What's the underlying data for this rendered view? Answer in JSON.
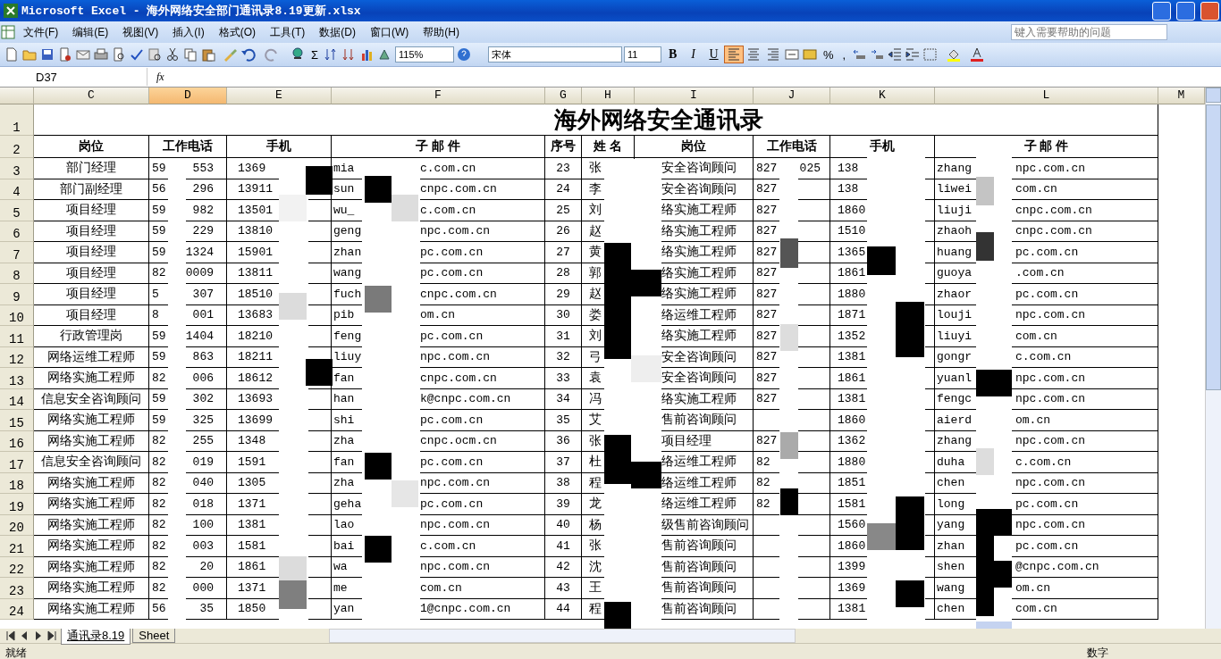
{
  "window": {
    "title": "Microsoft Excel - 海外网络安全部门通讯录8.19更新.xlsx"
  },
  "menu": [
    "文件(F)",
    "编辑(E)",
    "视图(V)",
    "插入(I)",
    "格式(O)",
    "工具(T)",
    "数据(D)",
    "窗口(W)",
    "帮助(H)"
  ],
  "help_box": {
    "placeholder": "键入需要帮助的问题"
  },
  "toolbar": {
    "zoom": "115%",
    "sum": "Σ",
    "font": "宋体",
    "size": "11",
    "bold": "B",
    "italic": "I",
    "underline": "U",
    "percent": "%",
    "comma": ",",
    "align": [
      {
        "selected": true
      },
      {
        "selected": false
      },
      {
        "selected": false
      }
    ]
  },
  "formula_bar": {
    "cell": "D37",
    "fx": "fx"
  },
  "columns": [
    {
      "label": "C",
      "selected": false
    },
    {
      "label": "D",
      "selected": true
    },
    {
      "label": "E",
      "selected": false
    },
    {
      "label": "F",
      "selected": false
    },
    {
      "label": "G",
      "selected": false
    },
    {
      "label": "H",
      "selected": false
    },
    {
      "label": "I",
      "selected": false
    },
    {
      "label": "J",
      "selected": false
    },
    {
      "label": "K",
      "selected": false
    },
    {
      "label": "L",
      "selected": false
    },
    {
      "label": "M",
      "selected": false
    }
  ],
  "sheet_title": {
    "row": "1",
    "text": "海外网络安全通讯录"
  },
  "header": {
    "row": "2",
    "left": [
      "岗位",
      "工作电话",
      "手机",
      "子 邮 件"
    ],
    "right": [
      "序号",
      "姓  名",
      "岗位",
      "工作电话",
      "手机",
      "子 邮 件"
    ]
  },
  "rows": [
    {
      "num": "3",
      "left": {
        "post": "部门经理",
        "tel": [
          "59",
          "553"
        ],
        "mobile": "1369",
        "email": [
          "mia",
          "c.com.cn"
        ]
      },
      "right": {
        "seq": "23",
        "name": "张",
        "post": "安全咨询顾问",
        "tel": [
          "827",
          "025"
        ],
        "mobile": "138",
        "email": [
          "zhang",
          "npc.com.cn"
        ]
      }
    },
    {
      "num": "4",
      "left": {
        "post": "部门副经理",
        "tel": [
          "56",
          "296"
        ],
        "mobile": "13911",
        "email": [
          "sun",
          "cnpc.com.cn"
        ]
      },
      "right": {
        "seq": "24",
        "name": "李",
        "post": "安全咨询顾问",
        "tel": [
          "827"
        ],
        "mobile": "138",
        "email": [
          "liwei",
          "com.cn"
        ]
      }
    },
    {
      "num": "5",
      "left": {
        "post": "项目经理",
        "tel": [
          "59",
          "982"
        ],
        "mobile": "13501",
        "email": [
          "wu_",
          "c.com.cn"
        ]
      },
      "right": {
        "seq": "25",
        "name": "刘",
        "post": "络实施工程师",
        "tel": [
          "827"
        ],
        "mobile": "1860",
        "email": [
          "liuji",
          "cnpc.com.cn"
        ]
      }
    },
    {
      "num": "6",
      "left": {
        "post": "项目经理",
        "tel": [
          "59",
          "229"
        ],
        "mobile": "13810",
        "email": [
          "geng",
          "npc.com.cn"
        ]
      },
      "right": {
        "seq": "26",
        "name": "赵",
        "post": "络实施工程师",
        "tel": [
          "827"
        ],
        "mobile": "1510",
        "email": [
          "zhaoh",
          "cnpc.com.cn"
        ]
      }
    },
    {
      "num": "7",
      "left": {
        "post": "项目经理",
        "tel": [
          "59",
          "1324"
        ],
        "mobile": "15901",
        "email": [
          "zhan",
          "pc.com.cn"
        ]
      },
      "right": {
        "seq": "27",
        "name": "黄",
        "post": "络实施工程师",
        "tel": [
          "827"
        ],
        "mobile": "1365",
        "email": [
          "huang",
          "pc.com.cn"
        ]
      }
    },
    {
      "num": "8",
      "left": {
        "post": "项目经理",
        "tel": [
          "82",
          "0009"
        ],
        "mobile": "13811",
        "email": [
          "wang",
          "pc.com.cn"
        ]
      },
      "right": {
        "seq": "28",
        "name": "郭",
        "post": "络实施工程师",
        "tel": [
          "827"
        ],
        "mobile": "1861",
        "email": [
          "guoya",
          ".com.cn"
        ]
      }
    },
    {
      "num": "9",
      "left": {
        "post": "项目经理",
        "tel": [
          "5",
          "307"
        ],
        "mobile": "18510",
        "email": [
          "fuch",
          "cnpc.com.cn"
        ]
      },
      "right": {
        "seq": "29",
        "name": "赵",
        "post": "络实施工程师",
        "tel": [
          "827"
        ],
        "mobile": "1880",
        "email": [
          "zhaor",
          "pc.com.cn"
        ]
      }
    },
    {
      "num": "10",
      "left": {
        "post": "项目经理",
        "tel": [
          "8",
          "001"
        ],
        "mobile": "13683",
        "email": [
          "pib",
          "om.cn"
        ]
      },
      "right": {
        "seq": "30",
        "name": "娄",
        "post": "络运维工程师",
        "tel": [
          "827"
        ],
        "mobile": "1871",
        "email": [
          "louji",
          "npc.com.cn"
        ]
      }
    },
    {
      "num": "11",
      "left": {
        "post": "行政管理岗",
        "tel": [
          "59",
          "1404"
        ],
        "mobile": "18210",
        "email": [
          "feng",
          "pc.com.cn"
        ]
      },
      "right": {
        "seq": "31",
        "name": "刘",
        "post": "络实施工程师",
        "tel": [
          "827"
        ],
        "mobile": "1352",
        "email": [
          "liuyi",
          "com.cn"
        ]
      }
    },
    {
      "num": "12",
      "left": {
        "post": "网络运维工程师",
        "tel": [
          "59",
          "863"
        ],
        "mobile": "18211",
        "email": [
          "liuy",
          "npc.com.cn"
        ]
      },
      "right": {
        "seq": "32",
        "name": "弓",
        "post": "安全咨询顾问",
        "tel": [
          "827"
        ],
        "mobile": "1381",
        "email": [
          "gongr",
          "c.com.cn"
        ]
      }
    },
    {
      "num": "13",
      "left": {
        "post": "网络实施工程师",
        "tel": [
          "82",
          "006"
        ],
        "mobile": "18612",
        "email": [
          "fan",
          "cnpc.com.cn"
        ]
      },
      "right": {
        "seq": "33",
        "name": "袁",
        "post": "安全咨询顾问",
        "tel": [
          "827"
        ],
        "mobile": "1861",
        "email": [
          "yuanl",
          "npc.com.cn"
        ]
      }
    },
    {
      "num": "14",
      "left": {
        "post": "信息安全咨询顾问",
        "tel": [
          "59",
          "302"
        ],
        "mobile": "13693",
        "email": [
          "han",
          "k@cnpc.com.cn"
        ]
      },
      "right": {
        "seq": "34",
        "name": "冯",
        "post": "络实施工程师",
        "tel": [
          "827"
        ],
        "mobile": "1381",
        "email": [
          "fengc",
          "npc.com.cn"
        ]
      }
    },
    {
      "num": "15",
      "left": {
        "post": "网络实施工程师",
        "tel": [
          "59",
          "325"
        ],
        "mobile": "13699",
        "email": [
          "shi",
          "pc.com.cn"
        ]
      },
      "right": {
        "seq": "35",
        "name": "艾",
        "post": "售前咨询顾问",
        "mobile": "1860",
        "email": [
          "aierd",
          "om.cn"
        ]
      }
    },
    {
      "num": "16",
      "left": {
        "post": "网络实施工程师",
        "tel": [
          "82",
          "255"
        ],
        "mobile": "1348",
        "email": [
          "zha",
          "cnpc.ocm.cn"
        ]
      },
      "right": {
        "seq": "36",
        "name": "张",
        "post": "项目经理",
        "tel": [
          "827"
        ],
        "mobile": "1362",
        "email": [
          "zhang",
          "npc.com.cn"
        ]
      }
    },
    {
      "num": "17",
      "left": {
        "post": "信息安全咨询顾问",
        "tel": [
          "82",
          "019"
        ],
        "mobile": "1591",
        "email": [
          "fan",
          "pc.com.cn"
        ]
      },
      "right": {
        "seq": "37",
        "name": "杜",
        "post": "络运维工程师",
        "tel": [
          "82"
        ],
        "mobile": "1880",
        "email": [
          "duha",
          "c.com.cn"
        ]
      }
    },
    {
      "num": "18",
      "left": {
        "post": "网络实施工程师",
        "tel": [
          "82",
          "040"
        ],
        "mobile": "1305",
        "email": [
          "zha",
          "npc.com.cn"
        ]
      },
      "right": {
        "seq": "38",
        "name": "程",
        "post": "络运维工程师",
        "tel": [
          "82"
        ],
        "mobile": "1851",
        "email": [
          "chen",
          "npc.com.cn"
        ]
      }
    },
    {
      "num": "19",
      "left": {
        "post": "网络实施工程师",
        "tel": [
          "82",
          "018"
        ],
        "mobile": "1371",
        "email": [
          "geha",
          "pc.com.cn"
        ]
      },
      "right": {
        "seq": "39",
        "name": "龙",
        "post": "络运维工程师",
        "tel": [
          "82"
        ],
        "mobile": "1581",
        "email": [
          "long",
          "pc.com.cn"
        ]
      }
    },
    {
      "num": "20",
      "left": {
        "post": "网络实施工程师",
        "tel": [
          "82",
          "100"
        ],
        "mobile": "1381",
        "email": [
          "lao",
          "npc.com.cn"
        ]
      },
      "right": {
        "seq": "40",
        "name": "杨",
        "post": "级售前咨询顾问",
        "mobile": "1560",
        "email": [
          "yang",
          "npc.com.cn"
        ]
      }
    },
    {
      "num": "21",
      "left": {
        "post": "网络实施工程师",
        "tel": [
          "82",
          "003"
        ],
        "mobile": "1581",
        "email": [
          "bai",
          "c.com.cn"
        ]
      },
      "right": {
        "seq": "41",
        "name": "张",
        "post": "售前咨询顾问",
        "mobile": "1860",
        "email": [
          "zhan",
          "pc.com.cn"
        ]
      }
    },
    {
      "num": "22",
      "left": {
        "post": "网络实施工程师",
        "tel": [
          "82",
          "20"
        ],
        "mobile": "1861",
        "email": [
          "wa",
          "npc.com.cn"
        ]
      },
      "right": {
        "seq": "42",
        "name": "沈",
        "post": "售前咨询顾问",
        "mobile": "1399",
        "email": [
          "shen",
          "@cnpc.com.cn"
        ]
      }
    },
    {
      "num": "23",
      "left": {
        "post": "网络实施工程师",
        "tel": [
          "82",
          "000"
        ],
        "mobile": "1371",
        "email": [
          "me",
          "com.cn"
        ]
      },
      "right": {
        "seq": "43",
        "name": "王",
        "post": "售前咨询顾问",
        "mobile": "1369",
        "email": [
          "wang",
          "om.cn"
        ]
      }
    },
    {
      "num": "24",
      "left": {
        "post": "网络实施工程师",
        "tel": [
          "56",
          "35"
        ],
        "mobile": "1850",
        "email": [
          "yan",
          "1@cnpc.com.cn"
        ]
      },
      "right": {
        "seq": "44",
        "name": "程",
        "post": "售前咨询顾问",
        "mobile": "1381",
        "email": [
          "chen",
          "com.cn"
        ]
      }
    }
  ],
  "sheet_tabs": [
    {
      "label": "通讯录8.19",
      "selected": true
    },
    {
      "label": "Sheet",
      "selected": false
    }
  ],
  "status_bar": {
    "left": "就绪",
    "right": "数字"
  }
}
